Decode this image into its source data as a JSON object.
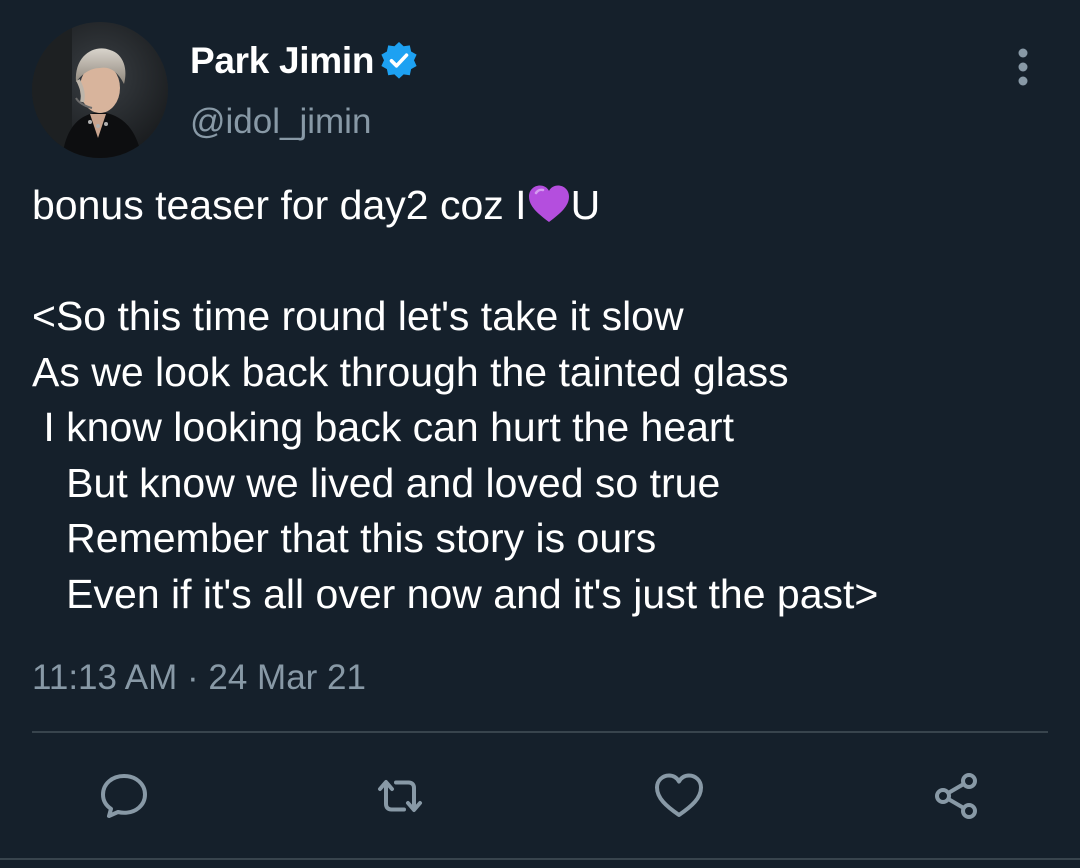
{
  "author": {
    "display_name": "Park Jimin",
    "handle": "@idol_jimin",
    "verified": true,
    "avatar_icon": "profile-photo"
  },
  "tweet": {
    "line1_before_emoji": "bonus teaser for day2 coz I",
    "emoji": "purple-heart",
    "line1_after_emoji": "U",
    "lines": [
      "<So this time round let's take it slow",
      "As we look back through the tainted glass",
      " I know looking back can hurt the heart",
      "   But know we lived and loved so true",
      "   Remember that this story is ours",
      "   Even if it's all over now and it's just the past>"
    ],
    "timestamp": "11:13 AM · 24 Mar 21"
  },
  "actions": {
    "reply_icon": "comment-icon",
    "retweet_icon": "retweet-icon",
    "like_icon": "heart-outline-icon",
    "share_icon": "share-icon"
  },
  "colors": {
    "background": "#15202b",
    "text_primary": "#ffffff",
    "text_secondary": "#8899a6",
    "verified_blue": "#1da1f2",
    "divider": "#38444d",
    "emoji_heart": "#b44ede"
  }
}
